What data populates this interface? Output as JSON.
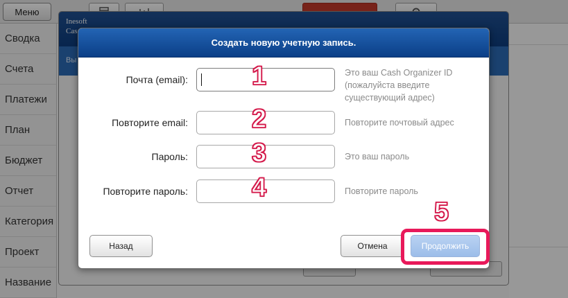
{
  "topbar": {
    "menu_label": "Меню"
  },
  "sidebar": {
    "items": [
      "Сводка",
      "Счета",
      "Платежи",
      "План",
      "Бюджет",
      "Отчет",
      "Категория",
      "Проект",
      "Название"
    ]
  },
  "back_window": {
    "title_line1": "Inesoft",
    "title_line2": "Cas",
    "subtitle": "Вы"
  },
  "dialog": {
    "title": "Создать новую учетную запись.",
    "fields": [
      {
        "label": "Почта (email):",
        "value": "",
        "hint": "Это ваш Cash Organizer ID (пожалуйста введите существующий адрес)",
        "step": "1"
      },
      {
        "label": "Повторите email:",
        "value": "",
        "hint": "Повторите почтовый адрес",
        "step": "2"
      },
      {
        "label": "Пароль:",
        "value": "",
        "hint": "Это ваш пароль",
        "step": "3"
      },
      {
        "label": "Повторите пароль:",
        "value": "",
        "hint": "Повторите пароль",
        "step": "4"
      }
    ],
    "buttons": {
      "back": "Назад",
      "cancel": "Отмена",
      "continue": "Продолжить"
    },
    "continue_step": "5"
  },
  "colors": {
    "header_blue": "#0b3f87",
    "highlight": "#e8195a",
    "continue_disabled": "#9cbde9"
  }
}
